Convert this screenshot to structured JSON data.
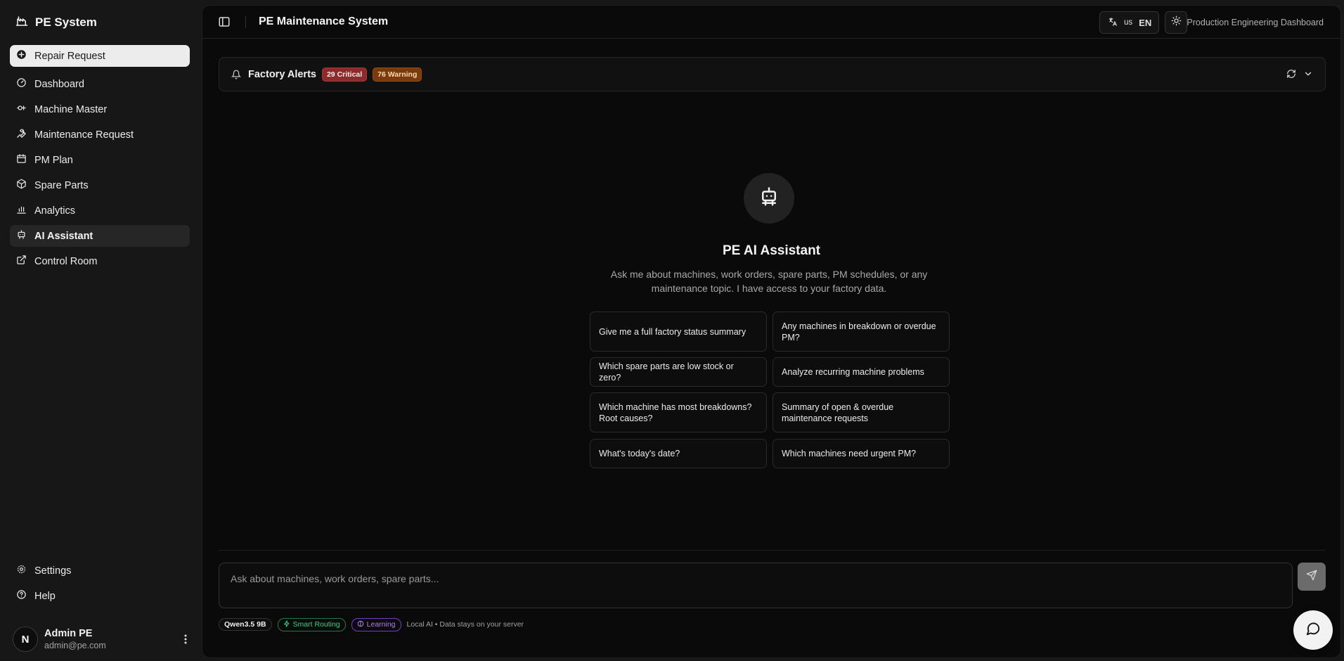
{
  "sidebar": {
    "brand": "PE System",
    "items": [
      {
        "label": "Repair Request",
        "icon": "plus-circle-icon"
      },
      {
        "label": "Dashboard",
        "icon": "gauge-icon"
      },
      {
        "label": "Machine Master",
        "icon": "cog-machine-icon"
      },
      {
        "label": "Maintenance Request",
        "icon": "wrench-icon"
      },
      {
        "label": "PM Plan",
        "icon": "calendar-icon"
      },
      {
        "label": "Spare Parts",
        "icon": "package-icon"
      },
      {
        "label": "Analytics",
        "icon": "bar-chart-icon"
      },
      {
        "label": "AI Assistant",
        "icon": "bot-icon"
      },
      {
        "label": "Control Room",
        "icon": "external-link-icon"
      }
    ],
    "bottom_items": [
      {
        "label": "Settings",
        "icon": "gear-icon"
      },
      {
        "label": "Help",
        "icon": "help-circle-icon"
      }
    ],
    "user": {
      "initial": "N",
      "name": "Admin PE",
      "email": "admin@pe.com"
    }
  },
  "header": {
    "title": "PE Maintenance System",
    "lang_flag": "us",
    "lang_code": "EN",
    "subtitle": "Production Engineering Dashboard"
  },
  "alerts": {
    "title": "Factory Alerts",
    "critical": "29 Critical",
    "warning": "76 Warning"
  },
  "assistant": {
    "title": "PE AI Assistant",
    "description": "Ask me about machines, work orders, spare parts, PM schedules, or any maintenance topic. I have access to your factory data.",
    "suggestions": [
      "Give me a full factory status summary",
      "Any machines in breakdown or overdue PM?",
      "Which spare parts are low stock or zero?",
      "Analyze recurring machine problems",
      "Which machine has most breakdowns? Root causes?",
      "Summary of open & overdue maintenance requests",
      "What's today's date?",
      "Which machines need urgent PM?"
    ]
  },
  "composer": {
    "placeholder": "Ask about machines, work orders, spare parts...",
    "model": "Qwen3.5 9B",
    "routing": "Smart Routing",
    "learning": "Learning",
    "note": "Local AI • Data stays on your server"
  },
  "colors": {
    "critical": "#8c2b2b",
    "warning": "#7a3a0f",
    "routing": "#3ecf7e",
    "learning": "#b07cf5"
  }
}
